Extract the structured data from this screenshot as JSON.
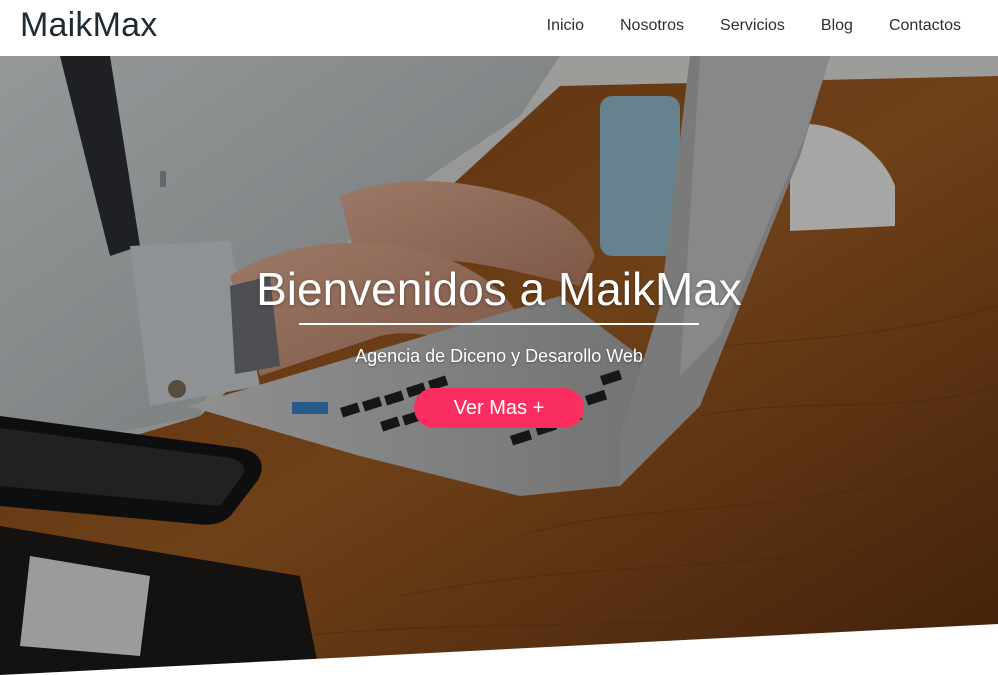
{
  "header": {
    "logo": "MaikMax",
    "nav": [
      "Inicio",
      "Nosotros",
      "Servicios",
      "Blog",
      "Contactos"
    ]
  },
  "hero": {
    "title": "Bienvenidos a MaikMax",
    "subtitle": "Agencia de Diceno y Desarollo Web",
    "button_label": "Ver Mas +"
  },
  "colors": {
    "accent": "#fb2e62",
    "logo_text": "#1e2a34",
    "nav_text": "#2a2f36"
  }
}
